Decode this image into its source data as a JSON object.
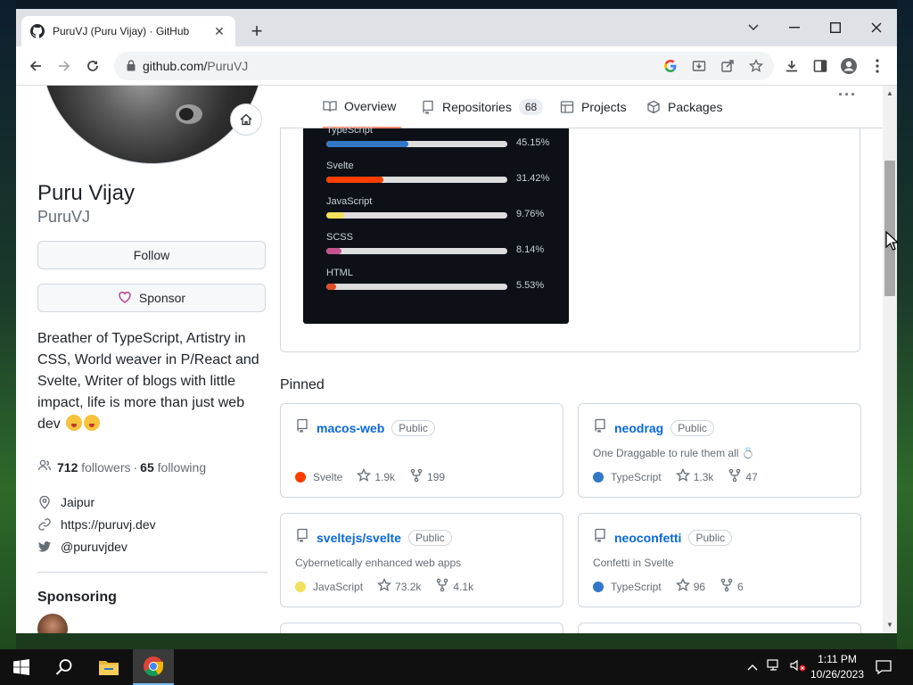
{
  "browser": {
    "tab_title": "PuruVJ (Puru Vijay) · GitHub",
    "url_domain": "github.com/",
    "url_path": "PuruVJ"
  },
  "profile": {
    "name": "Puru Vijay",
    "login": "PuruVJ",
    "follow_label": "Follow",
    "sponsor_label": "Sponsor",
    "bio": "Breather of TypeScript, Artistry in CSS, World weaver in P/React and Svelte, Writer of blogs with little impact, life is more than just web dev",
    "followers_count": "712",
    "followers_label": "followers",
    "separator": "·",
    "following_count": "65",
    "following_label": "following",
    "location": "Jaipur",
    "website": "https://puruvj.dev",
    "twitter": "@puruvjdev",
    "sponsoring_heading": "Sponsoring"
  },
  "nav": {
    "overview": "Overview",
    "repositories": "Repositories",
    "repositories_count": "68",
    "projects": "Projects",
    "packages": "Packages",
    "more": "···"
  },
  "languages": [
    {
      "name": "TypeScript",
      "percent_label": "45.15%",
      "percent": 45.15,
      "color": "#3178c6"
    },
    {
      "name": "Svelte",
      "percent_label": "31.42%",
      "percent": 31.42,
      "color": "#ff3e00"
    },
    {
      "name": "JavaScript",
      "percent_label": "9.76%",
      "percent": 9.76,
      "color": "#f1e05a"
    },
    {
      "name": "SCSS",
      "percent_label": "8.14%",
      "percent": 8.14,
      "color": "#c6538c"
    },
    {
      "name": "HTML",
      "percent_label": "5.53%",
      "percent": 5.53,
      "color": "#e34c26"
    }
  ],
  "pinned": {
    "heading": "Pinned",
    "public_label": "Public",
    "repos": [
      {
        "name": "macos-web",
        "description": "",
        "language": "Svelte",
        "lang_color": "#ff3e00",
        "stars": "1.9k",
        "forks": "199"
      },
      {
        "name": "neodrag",
        "description": "One Draggable to rule them all 💍",
        "language": "TypeScript",
        "lang_color": "#3178c6",
        "stars": "1.3k",
        "forks": "47"
      },
      {
        "name": "sveltejs/svelte",
        "description": "Cybernetically enhanced web apps",
        "language": "JavaScript",
        "lang_color": "#f1e05a",
        "stars": "73.2k",
        "forks": "4.1k"
      },
      {
        "name": "neoconfetti",
        "description": "Confetti in Svelte",
        "language": "TypeScript",
        "lang_color": "#3178c6",
        "stars": "96",
        "forks": "6"
      }
    ]
  },
  "taskbar": {
    "time": "1:11 PM",
    "date": "10/26/2023"
  }
}
